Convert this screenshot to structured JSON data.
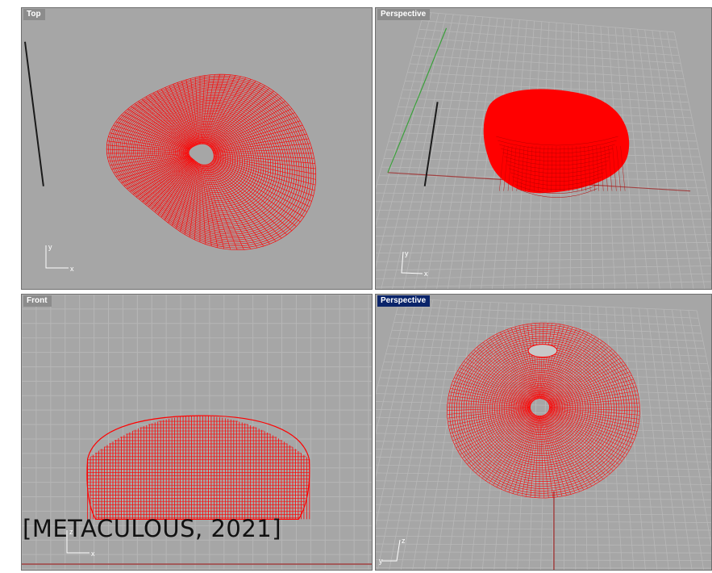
{
  "viewports": {
    "top": {
      "label": "Top",
      "active": false,
      "axis_h": "x",
      "axis_v": "y"
    },
    "persp1": {
      "label": "Perspective",
      "active": false,
      "axis_h": "x",
      "axis_v": "y"
    },
    "front": {
      "label": "Front",
      "active": false,
      "axis_h": "x",
      "axis_v": "z"
    },
    "persp2": {
      "label": "Perspective",
      "active": true,
      "axis_h": "y",
      "axis_v": "z"
    }
  },
  "caption": "[METACULOUS, 2021]",
  "colors": {
    "viewport_bg": "#a6a6a6",
    "grid_minor": "#b4b4b4",
    "grid_major": "#c6c6c6",
    "mesh": "#ff0000",
    "active_label_bg": "#0a246a"
  },
  "icons": {
    "gnomon": "axis-gnomon-icon"
  }
}
